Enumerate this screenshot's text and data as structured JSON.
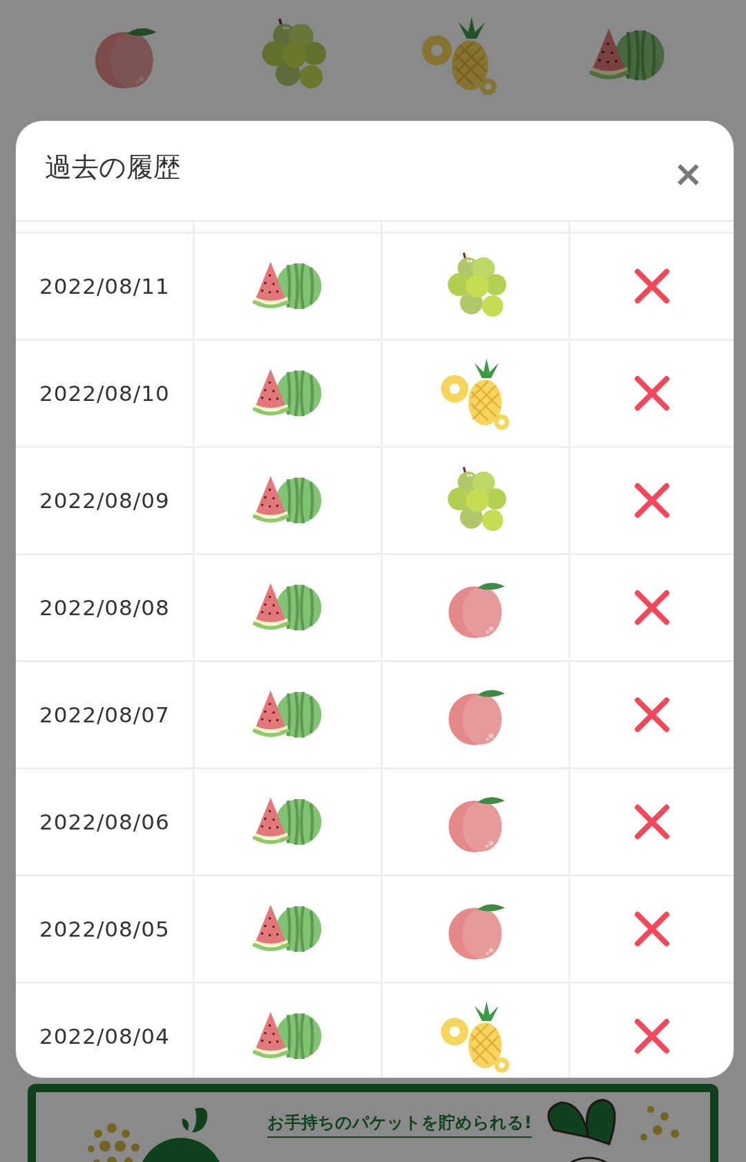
{
  "background": {
    "fruits": [
      {
        "kind": "peach"
      },
      {
        "kind": "grapes"
      },
      {
        "kind": "pineapple"
      },
      {
        "kind": "watermelon"
      }
    ],
    "banner": {
      "tagline": "お手持ちのパケットを貯められる!"
    }
  },
  "modal": {
    "title": "過去の履歴",
    "close": "×",
    "rows": [
      {
        "date": "2022/08/11",
        "cells": [
          {
            "kind": "watermelon"
          },
          {
            "kind": "grapes"
          },
          {
            "kind": "cross"
          }
        ]
      },
      {
        "date": "2022/08/10",
        "cells": [
          {
            "kind": "watermelon"
          },
          {
            "kind": "pineapple"
          },
          {
            "kind": "cross"
          }
        ]
      },
      {
        "date": "2022/08/09",
        "cells": [
          {
            "kind": "watermelon"
          },
          {
            "kind": "grapes"
          },
          {
            "kind": "cross"
          }
        ]
      },
      {
        "date": "2022/08/08",
        "cells": [
          {
            "kind": "watermelon"
          },
          {
            "kind": "peach"
          },
          {
            "kind": "cross"
          }
        ]
      },
      {
        "date": "2022/08/07",
        "cells": [
          {
            "kind": "watermelon"
          },
          {
            "kind": "peach"
          },
          {
            "kind": "cross"
          }
        ]
      },
      {
        "date": "2022/08/06",
        "cells": [
          {
            "kind": "watermelon"
          },
          {
            "kind": "peach"
          },
          {
            "kind": "cross"
          }
        ]
      },
      {
        "date": "2022/08/05",
        "cells": [
          {
            "kind": "watermelon"
          },
          {
            "kind": "peach"
          },
          {
            "kind": "cross"
          }
        ]
      },
      {
        "date": "2022/08/04",
        "cells": [
          {
            "kind": "watermelon"
          },
          {
            "kind": "pineapple"
          },
          {
            "kind": "cross"
          }
        ]
      }
    ]
  }
}
